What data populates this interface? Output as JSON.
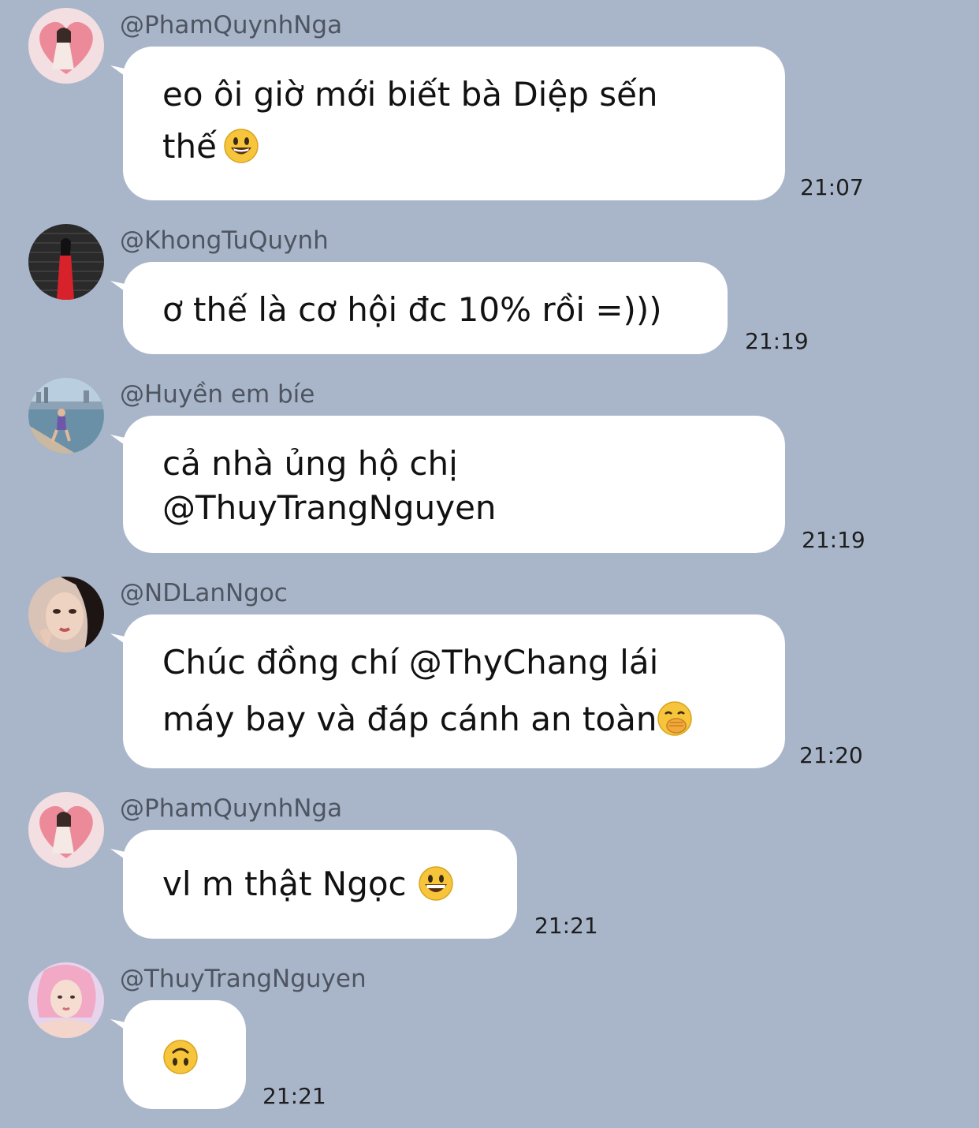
{
  "messages": [
    {
      "username": "@PhamQuynhNga",
      "lines": [
        "eo ôi giờ mới biết bà Diệp sến",
        "thế"
      ],
      "trailing_emoji": "grinning-face-big-eyes-emoji",
      "time": "21:07",
      "avatar_icon": "avatar-pink-heart-photo"
    },
    {
      "username": "@KhongTuQuynh",
      "lines": [
        "ơ thế là cơ hội đc 10% rồi =)))"
      ],
      "time": "21:19",
      "avatar_icon": "avatar-red-dress-photo"
    },
    {
      "username": "@Huyền em bíe",
      "lines": [
        "cả nhà ủng hộ chị",
        "@ThuyTrangNguyen"
      ],
      "time": "21:19",
      "avatar_icon": "avatar-harbor-photo"
    },
    {
      "username": "@NDLanNgoc",
      "lines": [
        "Chúc đồng chí @ThyChang lái",
        "máy bay và đáp cánh an toàn"
      ],
      "trailing_emoji": "face-with-hand-over-mouth-emoji",
      "time": "21:20",
      "avatar_icon": "avatar-portrait-photo"
    },
    {
      "username": "@PhamQuynhNga",
      "lines": [
        "vl m thật Ngọc"
      ],
      "trailing_emoji": "grinning-face-emoji",
      "time": "21:21",
      "avatar_icon": "avatar-pink-heart-photo"
    },
    {
      "username": "@ThuyTrangNguyen",
      "lines": [],
      "trailing_emoji": "upside-down-face-emoji",
      "time": "21:21",
      "avatar_icon": "avatar-pink-hair-photo"
    }
  ],
  "colors": {
    "background": "#a9b6ca",
    "bubble": "#ffffff",
    "username": "#4e5561",
    "emoji_yellow": "#f7c53b"
  }
}
